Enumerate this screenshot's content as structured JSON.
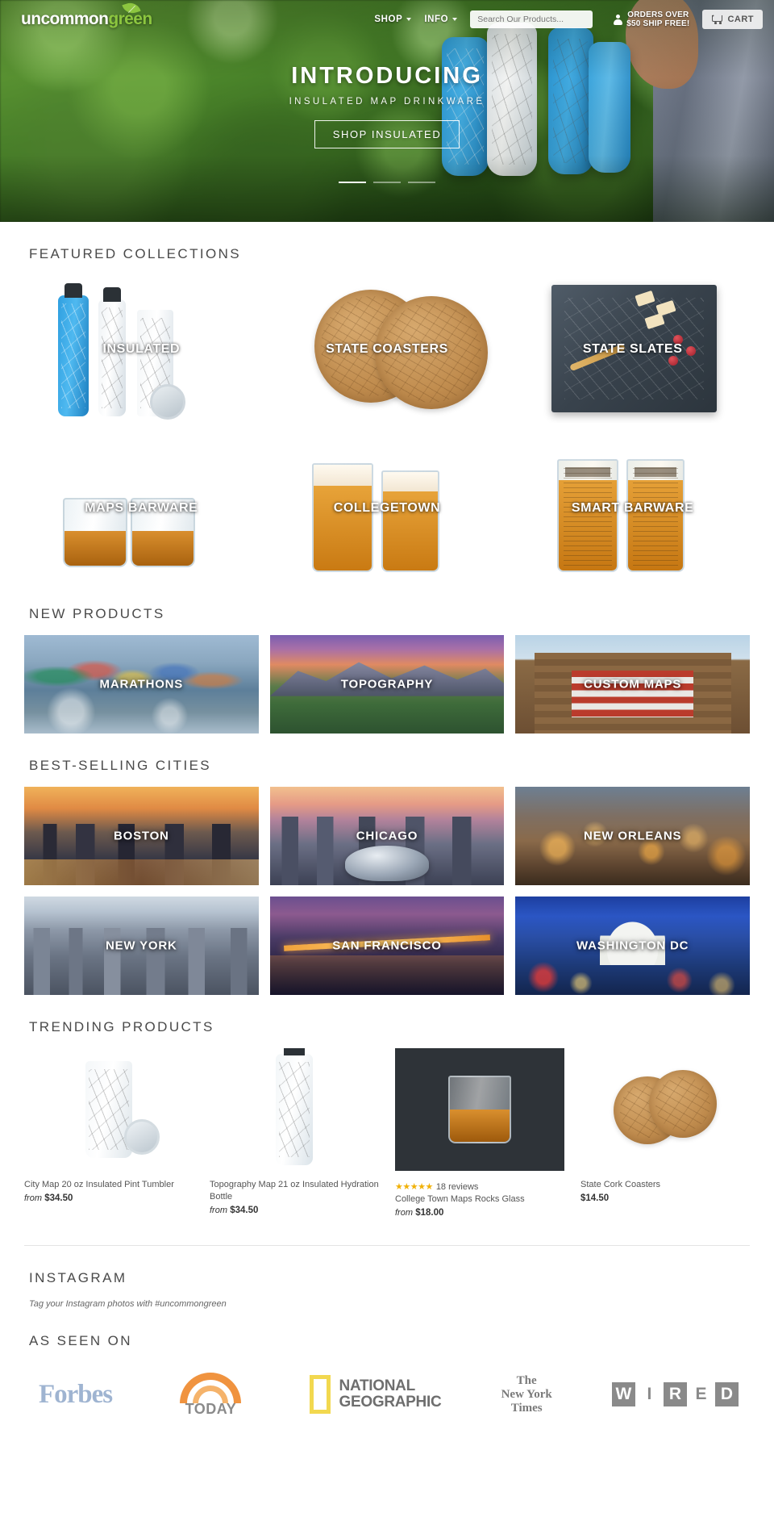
{
  "header": {
    "logo_text_left": "uncommon",
    "logo_text_right": "green",
    "nav": [
      {
        "label": "SHOP",
        "icon": "chevron-down-icon"
      },
      {
        "label": "INFO",
        "icon": "chevron-down-icon"
      }
    ],
    "search_placeholder": "Search Our Products...",
    "shipping_line1": "ORDERS OVER",
    "shipping_line2": "$50 SHIP FREE!",
    "cart_label": "CART",
    "account_icon": "person-icon",
    "cart_icon": "shopping-cart-icon"
  },
  "hero": {
    "title": "INTRODUCING",
    "subtitle": "INSULATED MAP DRINKWARE",
    "cta": "SHOP INSULATED",
    "slides": 3,
    "active_slide": 1
  },
  "sections": {
    "featured": "FEATURED COLLECTIONS",
    "new_products": "NEW PRODUCTS",
    "best_cities": "BEST-SELLING CITIES",
    "trending": "TRENDING PRODUCTS",
    "instagram": "INSTAGRAM",
    "instagram_note": "Tag your Instagram photos with #uncommongreen",
    "as_seen_on": "AS SEEN ON"
  },
  "featured_collections": [
    {
      "label": "INSULATED"
    },
    {
      "label": "STATE COASTERS"
    },
    {
      "label": "STATE SLATES"
    },
    {
      "label": "MAPS BARWARE"
    },
    {
      "label": "COLLEGETOWN"
    },
    {
      "label": "SMART BARWARE"
    }
  ],
  "new_products": [
    {
      "label": "MARATHONS"
    },
    {
      "label": "TOPOGRAPHY"
    },
    {
      "label": "CUSTOM MAPS"
    }
  ],
  "best_selling_cities": [
    {
      "label": "BOSTON"
    },
    {
      "label": "CHICAGO"
    },
    {
      "label": "NEW ORLEANS"
    },
    {
      "label": "NEW YORK"
    },
    {
      "label": "SAN FRANCISCO"
    },
    {
      "label": "WASHINGTON DC"
    }
  ],
  "trending_products": [
    {
      "name": "City Map 20 oz Insulated Pint Tumbler",
      "price_prefix": "from",
      "price": "$34.50",
      "reviews": "",
      "stars": ""
    },
    {
      "name": "Topography Map 21 oz Insulated Hydration Bottle",
      "price_prefix": "from",
      "price": "$34.50",
      "reviews": "",
      "stars": ""
    },
    {
      "name": "College Town Maps Rocks Glass",
      "price_prefix": "from",
      "price": "$18.00",
      "reviews": "18 reviews",
      "stars": "★★★★★"
    },
    {
      "name": "State Cork Coasters",
      "price_prefix": "",
      "price": "$14.50",
      "reviews": "",
      "stars": ""
    }
  ],
  "press_logos": [
    {
      "name": "Forbes",
      "text": "Forbes"
    },
    {
      "name": "Today",
      "text": "TODAY"
    },
    {
      "name": "National Geographic",
      "line1": "NATIONAL",
      "line2": "GEOGRAPHIC"
    },
    {
      "name": "The New York Times",
      "line1": "The",
      "line2": "New York",
      "line3": "Times"
    },
    {
      "name": "Wired",
      "letters": [
        "W",
        "I",
        "R",
        "E",
        "D"
      ]
    }
  ],
  "colors": {
    "brand_green": "#8cc63f",
    "star_gold": "#f1b108",
    "text_dark": "#3c3c3c",
    "forbes_blue": "#9fb4d1"
  }
}
